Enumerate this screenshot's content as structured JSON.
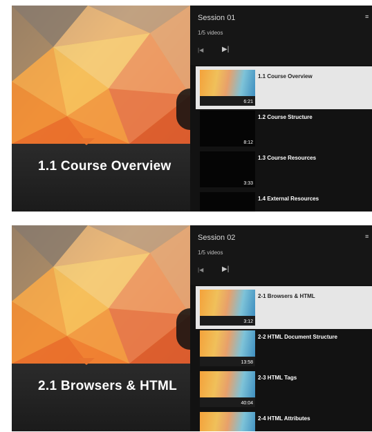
{
  "players": [
    {
      "video_title": "1.1 Course Overview",
      "session_title": "Session 01",
      "video_count": "1/5 videos",
      "playlist": [
        {
          "label": "1.1 Course Overview",
          "duration": "6:21",
          "thumbnail": "gradient",
          "active": true
        },
        {
          "label": "1.2 Course Structure",
          "duration": "8:12",
          "thumbnail": "dark",
          "active": false
        },
        {
          "label": "1.3 Course Resources",
          "duration": "3:33",
          "thumbnail": "dark",
          "active": false
        },
        {
          "label": "1.4 External Resources",
          "duration": "",
          "thumbnail": "dark",
          "active": false
        }
      ]
    },
    {
      "video_title": "2.1 Browsers & HTML",
      "session_title": "Session 02",
      "video_count": "1/5 videos",
      "playlist": [
        {
          "label": "2-1 Browsers & HTML",
          "duration": "3:12",
          "thumbnail": "gradient",
          "active": true
        },
        {
          "label": "2-2 HTML Document Structure",
          "duration": "13:58",
          "thumbnail": "gradient",
          "active": false
        },
        {
          "label": "2-3 HTML Tags",
          "duration": "40:04",
          "thumbnail": "gradient",
          "active": false
        },
        {
          "label": "2-4 HTML Attributes",
          "duration": "",
          "thumbnail": "gradient",
          "active": false
        }
      ]
    }
  ],
  "icons": {
    "prev": "skip-previous-icon",
    "next": "skip-next-icon",
    "menu": "playlist-menu-icon"
  },
  "colors": {
    "accent": "#e8742e",
    "active_item_bg": "#e6e6e6",
    "panel_bg": "#121212"
  }
}
